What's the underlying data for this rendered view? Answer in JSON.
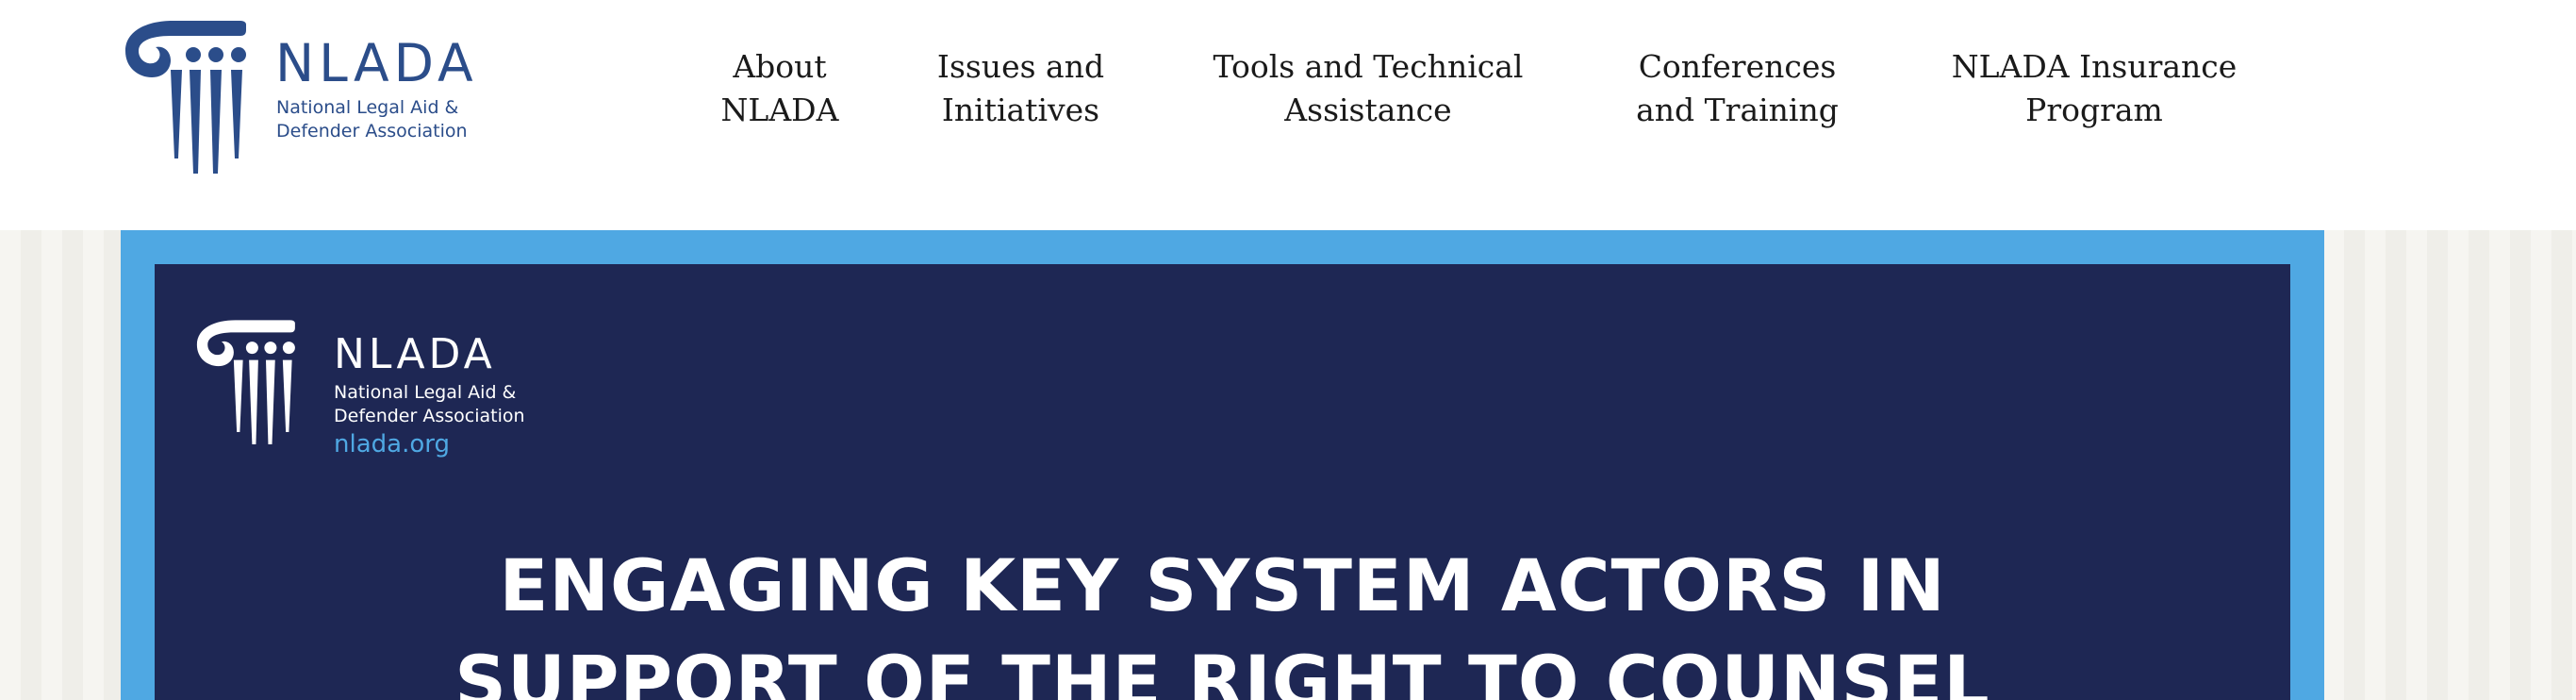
{
  "header": {
    "logo": {
      "wordmark": "NLADA",
      "tagline_line1": "National Legal Aid &",
      "tagline_line2": "Defender Association"
    },
    "nav": [
      {
        "line1": "About",
        "line2": "NLADA"
      },
      {
        "line1": "Issues and",
        "line2": "Initiatives"
      },
      {
        "line1": "Tools and Technical",
        "line2": "Assistance"
      },
      {
        "line1": "Conferences",
        "line2": "and Training"
      },
      {
        "line1": "NLADA Insurance",
        "line2": "Program"
      }
    ]
  },
  "banner": {
    "logo": {
      "wordmark": "NLADA",
      "tagline_line1": "National Legal Aid &",
      "tagline_line2": "Defender Association",
      "url": "nlada.org"
    },
    "heading_line1": "ENGAGING KEY SYSTEM ACTORS IN",
    "heading_line2": "SUPPORT OF THE RIGHT TO COUNSEL"
  },
  "colors": {
    "brand_blue": "#2b4d8a",
    "banner_navy": "#1e2754",
    "banner_border": "#4fa8e3"
  },
  "icons": {
    "logo_mark": "ionic-column-icon"
  }
}
